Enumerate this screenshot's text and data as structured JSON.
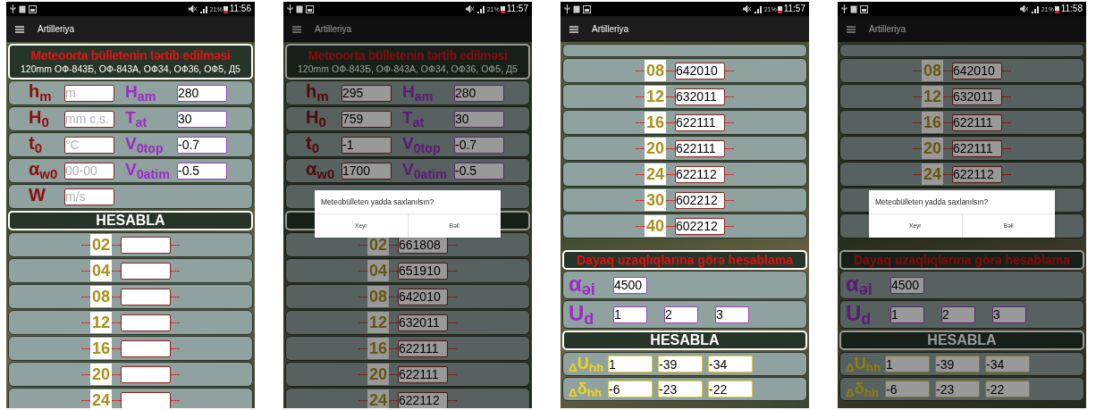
{
  "phones": [
    {
      "status": {
        "battery": "21%",
        "time": "11:56"
      },
      "app_bar": {
        "title": "Artilleriya"
      },
      "sections": [
        {
          "kind": "header",
          "title": "Meteoorta bülletenin tərtib edilməsi",
          "subtitle": "120mm ОФ-843Б, ОФ-843А, ОФ34, ОФ36, ОФ5, Д5"
        },
        {
          "kind": "pair",
          "fields": [
            {
              "label": "h$_{m}$",
              "kind": "measured",
              "placeholder": "m"
            },
            {
              "label": "H$_{am}$",
              "kind": "setting",
              "value": "280"
            }
          ]
        },
        {
          "kind": "pair",
          "fields": [
            {
              "label": "H$_{0}$",
              "kind": "measured",
              "placeholder": "mm c.s."
            },
            {
              "label": "T$_{at}$",
              "kind": "setting",
              "value": "30"
            }
          ]
        },
        {
          "kind": "pair",
          "fields": [
            {
              "label": "t$_{0}$",
              "kind": "measured",
              "placeholder": "°C"
            },
            {
              "label": "V$_{0top}$",
              "kind": "setting",
              "value": "-0.7"
            }
          ]
        },
        {
          "kind": "pair",
          "fields": [
            {
              "label": "α$_{w0}$",
              "kind": "measured",
              "placeholder": "00-00"
            },
            {
              "label": "V$_{0atim}$",
              "kind": "setting",
              "value": "-0.5"
            }
          ]
        },
        {
          "kind": "pair",
          "fields": [
            {
              "label": "W",
              "kind": "measured",
              "placeholder": "m/s"
            }
          ]
        },
        {
          "kind": "button",
          "label": "HESABLA"
        },
        {
          "kind": "altitude",
          "label": "02"
        },
        {
          "kind": "altitude",
          "label": "04"
        },
        {
          "kind": "altitude",
          "label": "08"
        },
        {
          "kind": "altitude",
          "label": "12"
        },
        {
          "kind": "altitude",
          "label": "16"
        },
        {
          "kind": "altitude",
          "label": "20"
        },
        {
          "kind": "altitude",
          "label": "24"
        }
      ]
    },
    {
      "status": {
        "battery": "21%",
        "time": "11:57"
      },
      "app_bar": {
        "title": "Artilleriya"
      },
      "sections": [
        {
          "kind": "header",
          "title": "Meteoorta bülletenin tərtib edilməsi",
          "subtitle": "120mm ОФ-843Б, ОФ-843А, ОФ34, ОФ36, ОФ5, Д5"
        },
        {
          "kind": "pair",
          "fields": [
            {
              "label": "h$_{m}$",
              "kind": "measured",
              "value": "295"
            },
            {
              "label": "H$_{am}$",
              "kind": "setting",
              "value": "280"
            }
          ]
        },
        {
          "kind": "pair",
          "fields": [
            {
              "label": "H$_{0}$",
              "kind": "measured",
              "value": "759"
            },
            {
              "label": "T$_{at}$",
              "kind": "setting",
              "value": "30"
            }
          ]
        },
        {
          "kind": "pair",
          "fields": [
            {
              "label": "t$_{0}$",
              "kind": "measured",
              "value": "-1"
            },
            {
              "label": "V$_{0top}$",
              "kind": "setting",
              "value": "-0.7"
            }
          ]
        },
        {
          "kind": "pair",
          "fields": [
            {
              "label": "α$_{w0}$",
              "kind": "measured",
              "value": "1700"
            },
            {
              "label": "V$_{0atim}$",
              "kind": "setting",
              "value": "-0.5"
            }
          ]
        },
        {
          "kind": "covered_row"
        },
        {
          "kind": "covered_button"
        },
        {
          "kind": "altitude",
          "label": "02",
          "value": "661808"
        },
        {
          "kind": "altitude",
          "label": "04",
          "value": "651910"
        },
        {
          "kind": "altitude",
          "label": "08",
          "value": "642010"
        },
        {
          "kind": "altitude",
          "label": "12",
          "value": "632011"
        },
        {
          "kind": "altitude",
          "label": "16",
          "value": "622111"
        },
        {
          "kind": "altitude",
          "label": "20",
          "value": "622111"
        },
        {
          "kind": "altitude",
          "label": "24",
          "value": "622112"
        }
      ],
      "dialog": {
        "message": "Meteobülleten yadda saxlanılsın?",
        "buttons": [
          "Xeyr",
          "Bəli"
        ]
      }
    },
    {
      "status": {
        "battery": "21%",
        "time": "11:57"
      },
      "app_bar": {
        "title": "Artilleriya"
      },
      "sections": [
        {
          "kind": "clipped_row"
        },
        {
          "kind": "altitude",
          "label": "08",
          "value": "642010"
        },
        {
          "kind": "altitude",
          "label": "12",
          "value": "632011"
        },
        {
          "kind": "altitude",
          "label": "16",
          "value": "622111"
        },
        {
          "kind": "altitude",
          "label": "20",
          "value": "622111"
        },
        {
          "kind": "altitude",
          "label": "24",
          "value": "622112"
        },
        {
          "kind": "altitude",
          "label": "30",
          "value": "602212"
        },
        {
          "kind": "altitude",
          "label": "40",
          "value": "602212"
        },
        {
          "kind": "section_title",
          "title": "Dayaq uzaqlıqlarına görə hesablama"
        },
        {
          "kind": "setting_row",
          "label": "α$_{əi}$",
          "values": [
            "4500"
          ]
        },
        {
          "kind": "setting_row",
          "label": "U$_{d}$",
          "values": [
            "1",
            "2",
            "3"
          ]
        },
        {
          "kind": "button",
          "label": "HESABLA"
        },
        {
          "kind": "result_row",
          "label": "$_{Δ}$U$_{hh}$",
          "values": [
            "1",
            "-39",
            "-34"
          ]
        },
        {
          "kind": "result_row",
          "label": "$_{Δ}$δ$_{hh}$",
          "values": [
            "-6",
            "-23",
            "-22"
          ]
        }
      ]
    },
    {
      "status": {
        "battery": "21%",
        "time": "11:58"
      },
      "app_bar": {
        "title": "Artilleriya"
      },
      "sections": [
        {
          "kind": "clipped_row"
        },
        {
          "kind": "altitude",
          "label": "08",
          "value": "642010"
        },
        {
          "kind": "altitude",
          "label": "12",
          "value": "632011"
        },
        {
          "kind": "altitude",
          "label": "16",
          "value": "622111"
        },
        {
          "kind": "altitude",
          "label": "20",
          "value": "622111"
        },
        {
          "kind": "altitude",
          "label": "24",
          "value": "622112"
        },
        {
          "kind": "covered_row"
        },
        {
          "kind": "covered_row"
        },
        {
          "kind": "section_title",
          "title": "Dayaq uzaqlıqlarına görə hesablama"
        },
        {
          "kind": "setting_row",
          "label": "α$_{əi}$",
          "values": [
            "4500"
          ]
        },
        {
          "kind": "setting_row",
          "label": "U$_{d}$",
          "values": [
            "1",
            "2",
            "3"
          ]
        },
        {
          "kind": "button",
          "label": "HESABLA"
        },
        {
          "kind": "result_row",
          "label": "$_{Δ}$U$_{hh}$",
          "values": [
            "1",
            "-39",
            "-34"
          ]
        },
        {
          "kind": "result_row",
          "label": "$_{Δ}$δ$_{hh}$",
          "values": [
            "-6",
            "-23",
            "-22"
          ]
        }
      ],
      "dialog": {
        "message": "Meteobülleten yadda saxlanılsın?",
        "buttons": [
          "Xeyr",
          "Bəli"
        ]
      }
    }
  ]
}
